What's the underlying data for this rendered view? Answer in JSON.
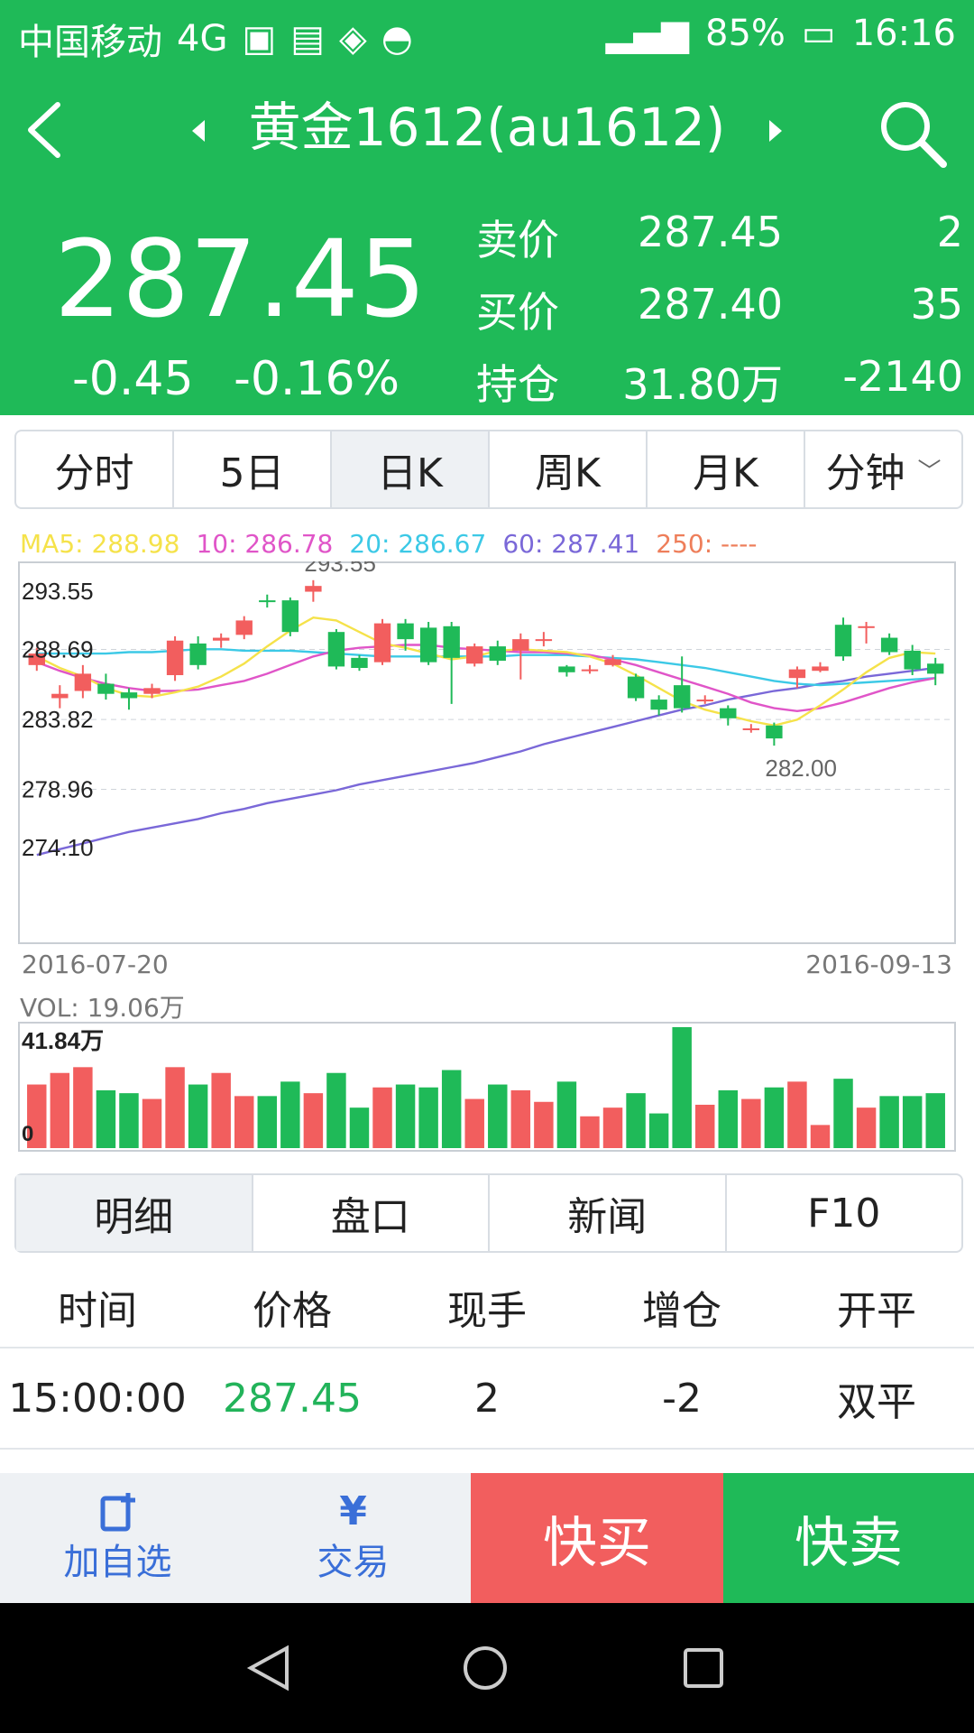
{
  "status": {
    "carrier": "中国移动",
    "network": "4G",
    "battery": "85%",
    "time": "16:16"
  },
  "header": {
    "title": "黄金1612(au1612)",
    "price": "287.45",
    "change": "-0.45",
    "change_pct": "-0.16%",
    "rows": [
      {
        "label": "卖价",
        "value": "287.45",
        "num": "2"
      },
      {
        "label": "买价",
        "value": "287.40",
        "num": "35"
      },
      {
        "label": "持仓",
        "value": "31.80万",
        "num": "-2140"
      }
    ]
  },
  "tabs": [
    "分时",
    "5日",
    "日K",
    "周K",
    "月K",
    "分钟"
  ],
  "active_tab": 2,
  "ma": [
    {
      "text": "MA5: 288.98",
      "color": "#f5e24a"
    },
    {
      "text": "10: 286.78",
      "color": "#e055c8"
    },
    {
      "text": "20: 286.67",
      "color": "#3cc9e6"
    },
    {
      "text": "60: 287.41",
      "color": "#7a68d8"
    },
    {
      "text": "250: ----",
      "color": "#ee7e5a"
    }
  ],
  "chart_data": {
    "type": "candlestick",
    "ylim": [
      274.1,
      293.55
    ],
    "y_ticks": [
      "293.55",
      "288.69",
      "283.82",
      "278.96",
      "274.10"
    ],
    "y_values": [
      293.55,
      288.69,
      283.82,
      278.96,
      274.1
    ],
    "x_start": "2016-07-20",
    "x_end": "2016-09-13",
    "high_label": "293.55",
    "low_label": "282.00",
    "candles": [
      {
        "o": 287.6,
        "c": 288.4,
        "h": 288.8,
        "l": 287.2
      },
      {
        "o": 285.3,
        "c": 285.6,
        "h": 286.2,
        "l": 284.6
      },
      {
        "o": 285.8,
        "c": 287.0,
        "h": 287.6,
        "l": 285.3
      },
      {
        "o": 286.3,
        "c": 285.6,
        "h": 287.0,
        "l": 285.2
      },
      {
        "o": 285.7,
        "c": 285.3,
        "h": 286.0,
        "l": 284.5
      },
      {
        "o": 285.6,
        "c": 286.0,
        "h": 286.3,
        "l": 285.3
      },
      {
        "o": 286.9,
        "c": 289.3,
        "h": 289.6,
        "l": 286.5
      },
      {
        "o": 289.1,
        "c": 287.6,
        "h": 289.6,
        "l": 287.3
      },
      {
        "o": 289.3,
        "c": 289.5,
        "h": 289.8,
        "l": 288.8
      },
      {
        "o": 289.7,
        "c": 290.7,
        "h": 291.0,
        "l": 289.4
      },
      {
        "o": 292.1,
        "c": 292.0,
        "h": 292.5,
        "l": 291.6
      },
      {
        "o": 292.1,
        "c": 289.9,
        "h": 292.3,
        "l": 289.6
      },
      {
        "o": 292.7,
        "c": 293.1,
        "h": 293.5,
        "l": 292.0
      },
      {
        "o": 289.9,
        "c": 287.5,
        "h": 290.1,
        "l": 287.3
      },
      {
        "o": 288.1,
        "c": 287.4,
        "h": 288.3,
        "l": 287.2
      },
      {
        "o": 287.8,
        "c": 290.5,
        "h": 290.8,
        "l": 287.6
      },
      {
        "o": 290.5,
        "c": 289.4,
        "h": 290.8,
        "l": 288.6
      },
      {
        "o": 290.2,
        "c": 287.8,
        "h": 290.6,
        "l": 287.6
      },
      {
        "o": 290.3,
        "c": 288.1,
        "h": 290.6,
        "l": 284.9
      },
      {
        "o": 287.7,
        "c": 288.9,
        "h": 289.1,
        "l": 287.5
      },
      {
        "o": 288.9,
        "c": 287.9,
        "h": 289.3,
        "l": 287.6
      },
      {
        "o": 288.6,
        "c": 289.4,
        "h": 289.8,
        "l": 286.6
      },
      {
        "o": 289.4,
        "c": 289.4,
        "h": 289.9,
        "l": 288.9
      },
      {
        "o": 287.5,
        "c": 287.1,
        "h": 287.6,
        "l": 286.8
      },
      {
        "o": 287.3,
        "c": 287.3,
        "h": 287.6,
        "l": 287.0
      },
      {
        "o": 287.6,
        "c": 288.0,
        "h": 288.3,
        "l": 287.5
      },
      {
        "o": 286.8,
        "c": 285.3,
        "h": 287.0,
        "l": 285.1
      },
      {
        "o": 285.2,
        "c": 284.5,
        "h": 285.5,
        "l": 284.1
      },
      {
        "o": 286.2,
        "c": 284.6,
        "h": 288.2,
        "l": 284.3
      },
      {
        "o": 285.2,
        "c": 285.2,
        "h": 285.5,
        "l": 284.9
      },
      {
        "o": 284.6,
        "c": 283.9,
        "h": 284.8,
        "l": 283.4
      },
      {
        "o": 283.2,
        "c": 283.2,
        "h": 283.5,
        "l": 282.9
      },
      {
        "o": 283.4,
        "c": 282.5,
        "h": 283.6,
        "l": 282.0
      },
      {
        "o": 286.7,
        "c": 287.3,
        "h": 287.5,
        "l": 286.0
      },
      {
        "o": 287.2,
        "c": 287.5,
        "h": 287.8,
        "l": 287.1
      },
      {
        "o": 290.4,
        "c": 288.2,
        "h": 290.9,
        "l": 287.9
      },
      {
        "o": 290.3,
        "c": 290.3,
        "h": 290.6,
        "l": 289.1
      },
      {
        "o": 289.5,
        "c": 288.5,
        "h": 289.8,
        "l": 288.3
      },
      {
        "o": 288.6,
        "c": 287.3,
        "h": 289.0,
        "l": 286.9
      },
      {
        "o": 287.7,
        "c": 287.0,
        "h": 288.1,
        "l": 286.2
      }
    ],
    "ma5": [
      288.2,
      287.4,
      286.8,
      286.0,
      285.5,
      285.4,
      285.7,
      286.1,
      286.8,
      287.7,
      288.9,
      290.0,
      290.9,
      290.7,
      289.9,
      289.1,
      288.8,
      288.4,
      288.0,
      288.2,
      288.6,
      288.7,
      288.6,
      288.5,
      288.2,
      287.7,
      286.9,
      286.0,
      285.1,
      284.5,
      284.1,
      283.7,
      283.4,
      283.8,
      284.8,
      285.9,
      287.1,
      288.1,
      288.5,
      288.4
    ],
    "ma10": [
      287.8,
      287.2,
      286.7,
      286.3,
      286.0,
      285.8,
      285.8,
      285.9,
      286.2,
      286.5,
      287.0,
      287.6,
      288.2,
      288.6,
      288.8,
      288.9,
      289.0,
      289.0,
      288.8,
      288.7,
      288.6,
      288.5,
      288.5,
      288.4,
      288.3,
      288.0,
      287.6,
      287.1,
      286.6,
      286.1,
      285.6,
      285.0,
      284.6,
      284.4,
      284.6,
      285.0,
      285.5,
      286.0,
      286.4,
      286.7
    ],
    "ma20": [
      288.4,
      288.4,
      288.4,
      288.4,
      288.5,
      288.5,
      288.6,
      288.7,
      288.7,
      288.6,
      288.6,
      288.6,
      288.5,
      288.4,
      288.3,
      288.2,
      288.2,
      288.2,
      288.2,
      288.2,
      288.2,
      288.3,
      288.3,
      288.3,
      288.2,
      288.1,
      288.0,
      287.8,
      287.6,
      287.4,
      287.1,
      286.8,
      286.5,
      286.3,
      286.2,
      286.3,
      286.4,
      286.5,
      286.6,
      286.7
    ],
    "ma60": [
      274.4,
      274.8,
      275.2,
      275.6,
      276.0,
      276.3,
      276.6,
      276.9,
      277.3,
      277.6,
      278.0,
      278.3,
      278.6,
      278.9,
      279.3,
      279.6,
      279.9,
      280.2,
      280.5,
      280.8,
      281.2,
      281.6,
      282.1,
      282.5,
      282.9,
      283.3,
      283.7,
      284.1,
      284.5,
      284.8,
      285.2,
      285.5,
      285.8,
      286.0,
      286.3,
      286.5,
      286.8,
      287.0,
      287.2,
      287.4
    ]
  },
  "volume": {
    "label": "VOL: 19.06万",
    "max_label": "41.84万",
    "zero_label": "0",
    "max": 41.84,
    "values": [
      22,
      26,
      28,
      20,
      19,
      17,
      28,
      22,
      26,
      18,
      18,
      23,
      19,
      26,
      14,
      21,
      22,
      21,
      27,
      17,
      22,
      20,
      16,
      23,
      11,
      14,
      19,
      12,
      41.84,
      15,
      20,
      17,
      21,
      23,
      8,
      24,
      14,
      18,
      18,
      19
    ]
  },
  "subtabs": [
    "明细",
    "盘口",
    "新闻",
    "F10"
  ],
  "active_subtab": 0,
  "table": {
    "headers": [
      "时间",
      "价格",
      "现手",
      "增仓",
      "开平"
    ],
    "rows": [
      [
        "15:00:00",
        "287.45",
        "2",
        "-2",
        "双平"
      ]
    ]
  },
  "bottom": {
    "add_label": "加自选",
    "trade_label": "交易",
    "buy_label": "快买",
    "sell_label": "快卖"
  },
  "colors": {
    "up": "#f25e5e",
    "down": "#1fba58"
  }
}
